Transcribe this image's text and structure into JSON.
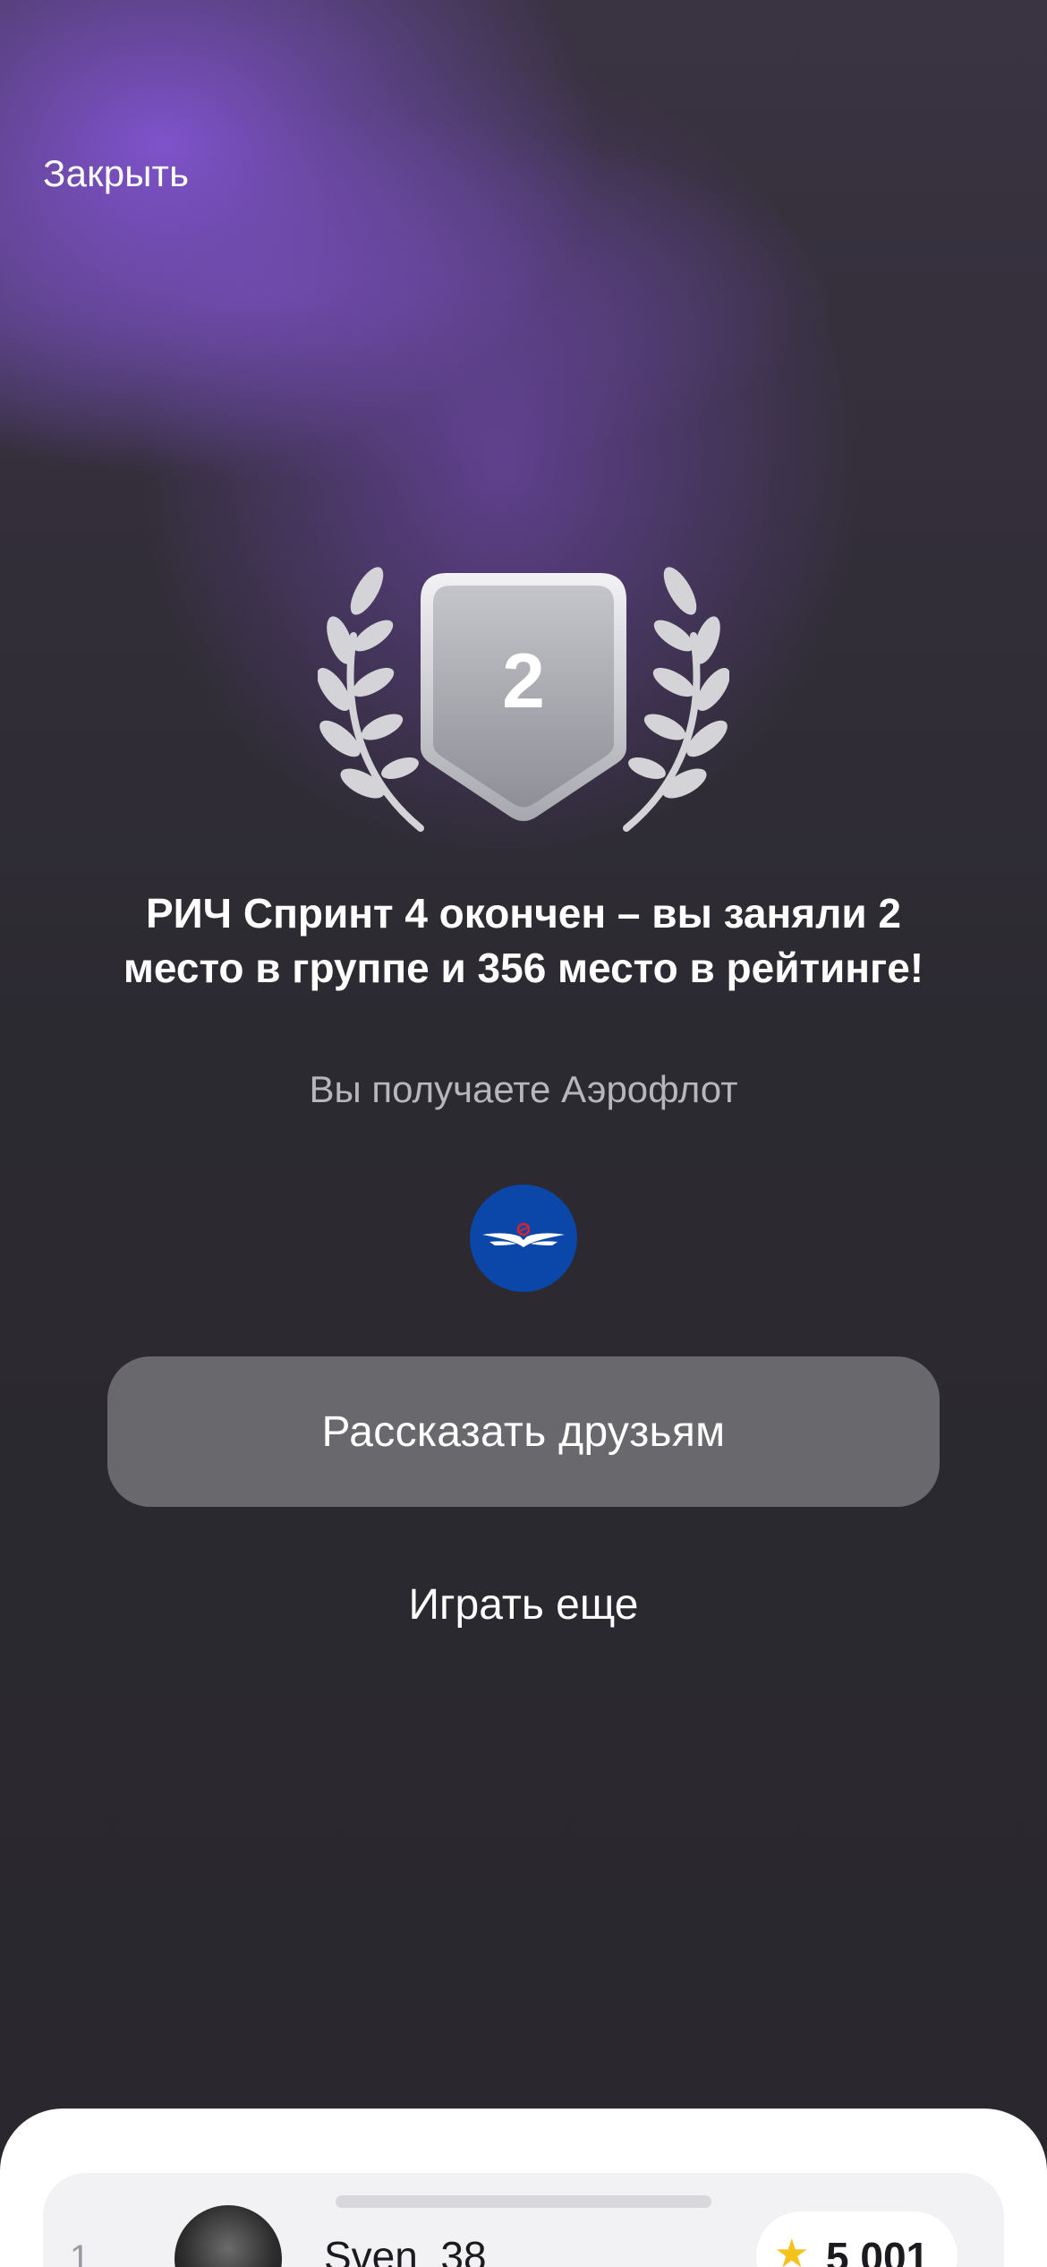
{
  "header": {
    "close_label": "Закрыть"
  },
  "result": {
    "place_in_badge": "2",
    "headline": "РИЧ Спринт 4 окончен – вы заняли 2 место в группе и 356 место в рейтинге!",
    "reward_text": "Вы получаете Аэрофлот",
    "reward_logo_icon": "aeroflot-logo-icon"
  },
  "actions": {
    "share_label": "Рассказать друзьям",
    "play_again_label": "Играть еще"
  },
  "leaderboard": {
    "entries": [
      {
        "rank": "1",
        "name": "Sven_38",
        "score": "5 001",
        "score_icon": "star-icon"
      }
    ]
  },
  "colors": {
    "accent_purple": "#8254d2",
    "button_bg": "#69686d",
    "reward_blue": "#0a47a8",
    "star": "#f5c21b"
  }
}
